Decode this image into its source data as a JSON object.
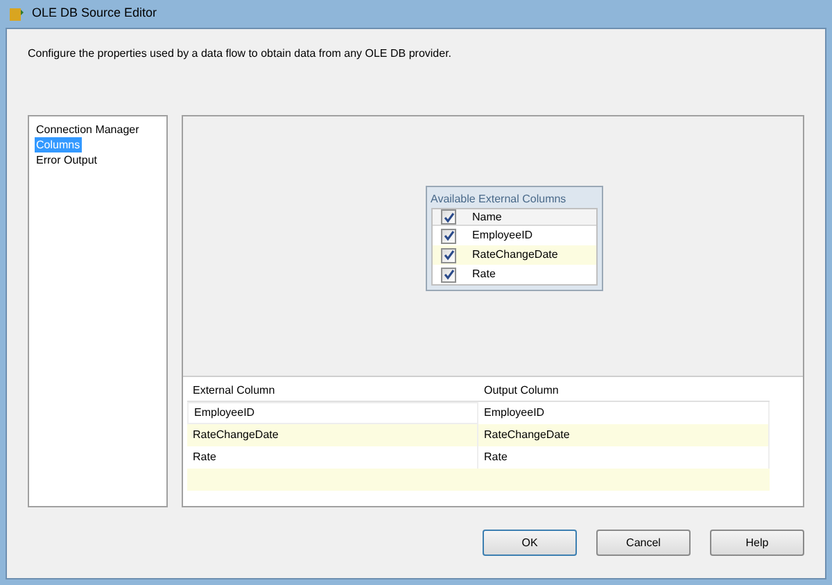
{
  "window": {
    "title": "OLE DB Source Editor"
  },
  "description": "Configure the properties used by a data flow to obtain data from any OLE DB provider.",
  "sidebar": {
    "items": [
      {
        "label": "Connection Manager",
        "selected": false
      },
      {
        "label": "Columns",
        "selected": true
      },
      {
        "label": "Error Output",
        "selected": false
      }
    ]
  },
  "available_columns": {
    "title": "Available External Columns",
    "header": {
      "label": "Name",
      "checked": true
    },
    "rows": [
      {
        "label": "EmployeeID",
        "checked": true
      },
      {
        "label": "RateChangeDate",
        "checked": true
      },
      {
        "label": "Rate",
        "checked": true
      }
    ]
  },
  "mapping_table": {
    "columns": [
      "External Column",
      "Output Column"
    ],
    "rows": [
      [
        "EmployeeID",
        "EmployeeID"
      ],
      [
        "RateChangeDate",
        "RateChangeDate"
      ],
      [
        "Rate",
        "Rate"
      ]
    ]
  },
  "buttons": [
    "OK",
    "Cancel",
    "Help"
  ]
}
